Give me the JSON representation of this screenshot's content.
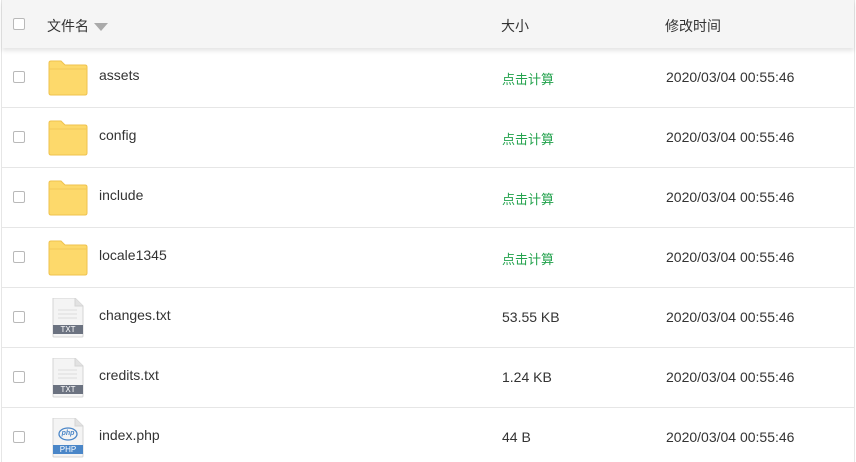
{
  "header": {
    "name_label": "文件名",
    "size_label": "大小",
    "time_label": "修改时间"
  },
  "colors": {
    "calc_link": "#23a24d",
    "folder": "#fdd96b",
    "txt_badge": "#6b7280",
    "php_badge": "#4a86c8"
  },
  "files": [
    {
      "name": "assets",
      "type": "folder",
      "icon": "folder-icon",
      "size": "点击计算",
      "modified": "2020/03/04 00:55:46"
    },
    {
      "name": "config",
      "type": "folder",
      "icon": "folder-icon",
      "size": "点击计算",
      "modified": "2020/03/04 00:55:46"
    },
    {
      "name": "include",
      "type": "folder",
      "icon": "folder-icon",
      "size": "点击计算",
      "modified": "2020/03/04 00:55:46"
    },
    {
      "name": "locale1345",
      "type": "folder",
      "icon": "folder-icon",
      "size": "点击计算",
      "modified": "2020/03/04 00:55:46"
    },
    {
      "name": "changes.txt",
      "type": "txt",
      "icon": "txt-file-icon",
      "badge": "TXT",
      "size": "53.55 KB",
      "modified": "2020/03/04 00:55:46"
    },
    {
      "name": "credits.txt",
      "type": "txt",
      "icon": "txt-file-icon",
      "badge": "TXT",
      "size": "1.24 KB",
      "modified": "2020/03/04 00:55:46"
    },
    {
      "name": "index.php",
      "type": "php",
      "icon": "php-file-icon",
      "badge": "PHP",
      "glyph": "php",
      "size": "44 B",
      "modified": "2020/03/04 00:55:46"
    }
  ]
}
